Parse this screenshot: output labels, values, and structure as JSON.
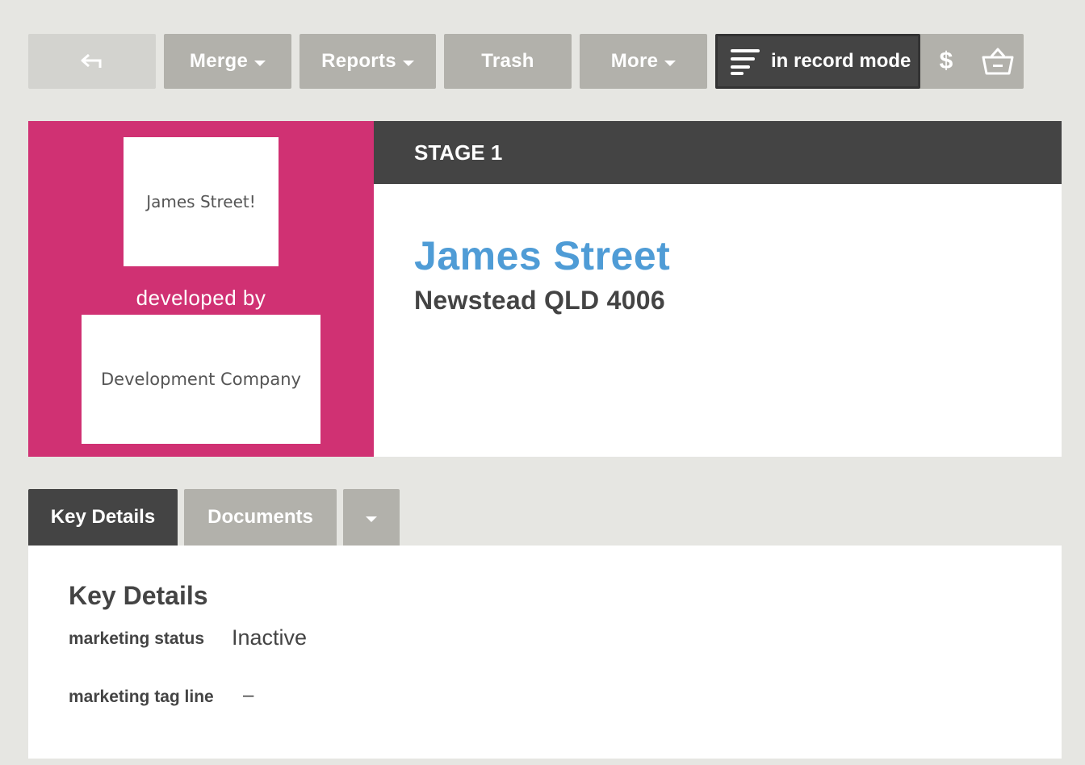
{
  "toolbar": {
    "back_icon": "back-arrow-icon",
    "merge_label": "Merge",
    "reports_label": "Reports",
    "trash_label": "Trash",
    "more_label": "More",
    "mode_label": "in record mode",
    "mode_icon": "lines-icon",
    "dollar_label": "$",
    "basket_icon": "basket-icon"
  },
  "header": {
    "project_logo_text": "James Street!",
    "developed_by": "developed by",
    "developer_logo_text": "Development Company",
    "stage": "STAGE 1",
    "title": "James Street",
    "address": "Newstead QLD 4006",
    "accent_color": "#d03173",
    "title_color": "#4f9cd6"
  },
  "tabs": {
    "items": [
      {
        "label": "Key Details",
        "active": true
      },
      {
        "label": "Documents",
        "active": false
      }
    ],
    "dropdown_icon": "chevron-down-icon"
  },
  "key_details": {
    "title": "Key Details",
    "fields": [
      {
        "label": "marketing status",
        "value": "Inactive"
      },
      {
        "label": "marketing tag line",
        "value": "–"
      }
    ]
  }
}
